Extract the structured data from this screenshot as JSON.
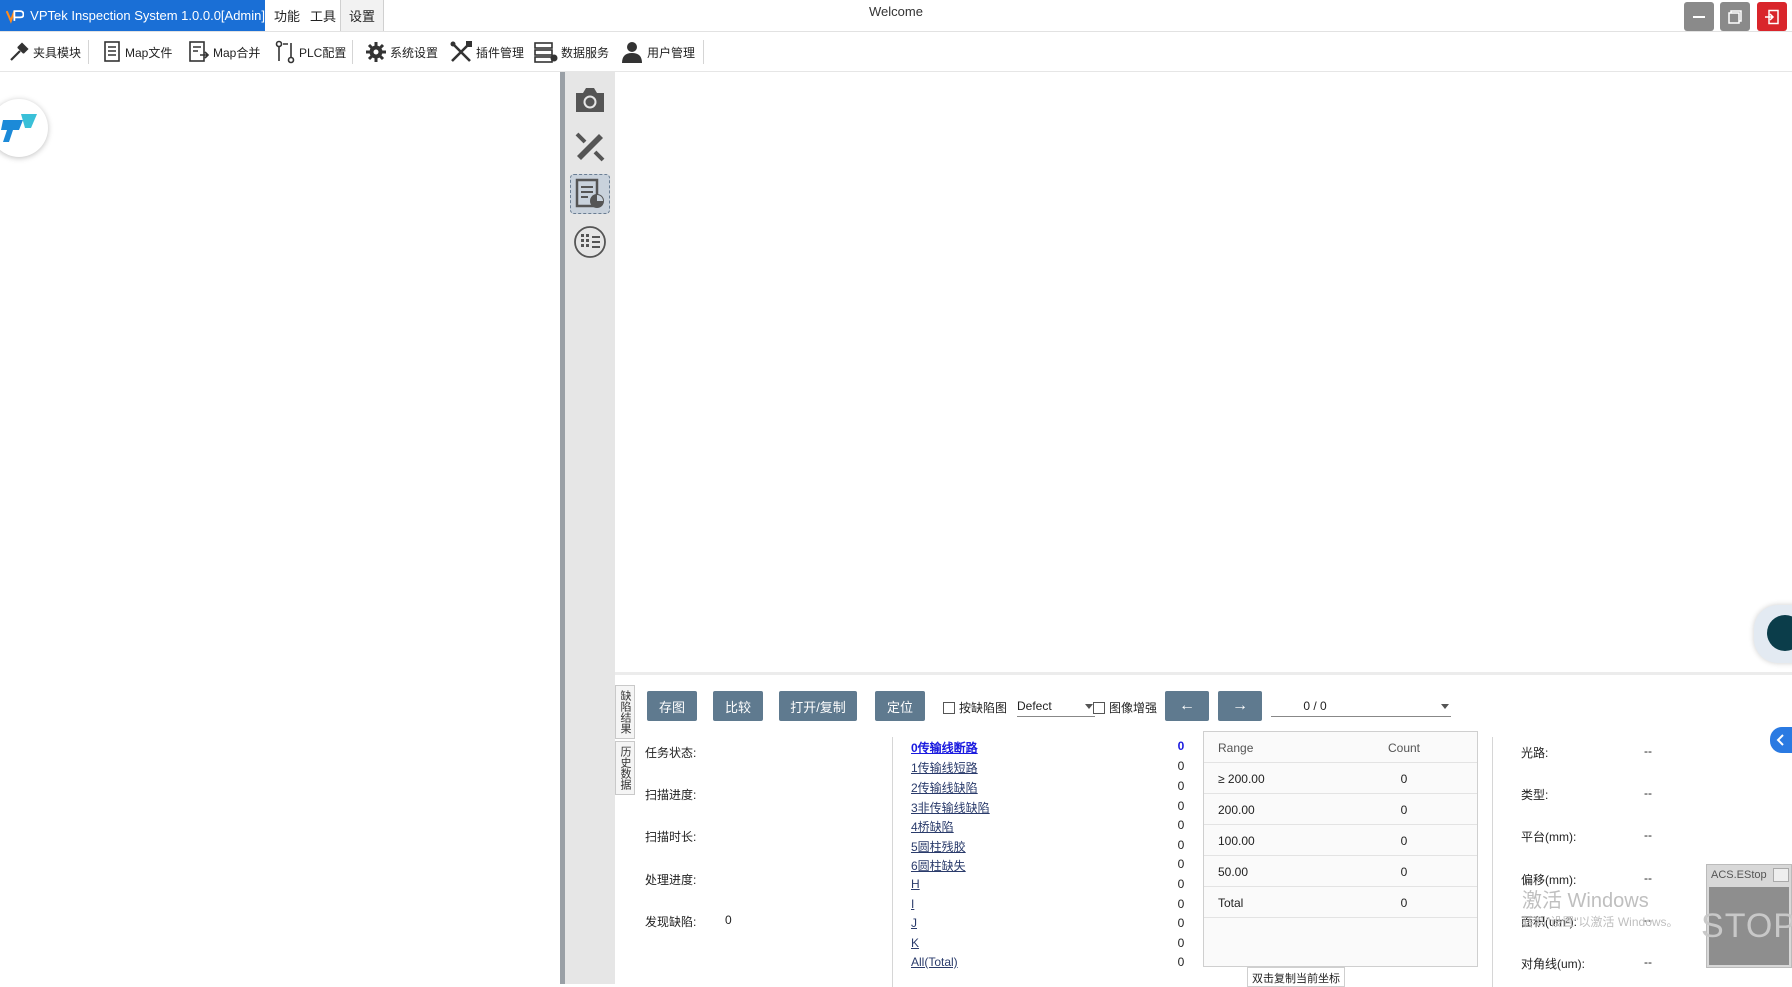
{
  "titlebar": {
    "app_name": "VPTek Inspection System 1.0.0.0[Admin]",
    "menus": [
      "功能",
      "工具",
      "设置"
    ],
    "window_title": "Welcome"
  },
  "toolbar": {
    "items": [
      {
        "label": "夹具模块",
        "icon": "fixture-icon"
      },
      {
        "label": "Map文件",
        "icon": "map-file-icon"
      },
      {
        "label": "Map合并",
        "icon": "map-merge-icon"
      },
      {
        "label": "PLC配置",
        "icon": "plc-icon"
      },
      {
        "label": "系统设置",
        "icon": "gear-icon"
      },
      {
        "label": "插件管理",
        "icon": "tools-icon"
      },
      {
        "label": "数据服务",
        "icon": "database-icon"
      },
      {
        "label": "用户管理",
        "icon": "user-icon"
      }
    ]
  },
  "side_strip": {
    "icons": [
      "camera-icon",
      "calibration-icon",
      "report-icon",
      "grid-list-icon"
    ]
  },
  "bottom": {
    "vtabs": [
      "缺陷结果",
      "历史数据"
    ],
    "buttons": {
      "save_image": "存图",
      "compare": "比较",
      "open_copy": "打开/复制",
      "locate": "定位",
      "prev": "←",
      "next": "→"
    },
    "checkbox_defect_map": "按缺陷图",
    "defect_select": "Defect",
    "checkbox_enhance": "图像增强",
    "page_indicator": "0 / 0",
    "status": {
      "task_state_label": "任务状态:",
      "task_state_value": "",
      "scan_progress_label": "扫描进度:",
      "scan_progress_value": "",
      "scan_time_label": "扫描时长:",
      "scan_time_value": "",
      "process_progress_label": "处理进度:",
      "process_progress_value": "",
      "defects_found_label": "发现缺陷:",
      "defects_found_value": "0"
    },
    "defects": [
      {
        "name": "0传输线断路",
        "count": "0"
      },
      {
        "name": "1传输线短路",
        "count": "0"
      },
      {
        "name": "2传输线缺陷",
        "count": "0"
      },
      {
        "name": "3非传输线缺陷",
        "count": "0"
      },
      {
        "name": "4桥缺陷",
        "count": "0"
      },
      {
        "name": "5圆柱残胶",
        "count": "0"
      },
      {
        "name": "6圆柱缺失",
        "count": "0"
      },
      {
        "name": "H",
        "count": "0"
      },
      {
        "name": "I",
        "count": "0"
      },
      {
        "name": "J",
        "count": "0"
      },
      {
        "name": "K",
        "count": "0"
      },
      {
        "name": "All(Total)",
        "count": "0"
      }
    ],
    "range_table": {
      "headers": [
        "Range",
        "Count"
      ],
      "rows": [
        {
          "range": "≥ 200.00",
          "count": "0"
        },
        {
          "range": "200.00",
          "count": "0"
        },
        {
          "range": "100.00",
          "count": "0"
        },
        {
          "range": "50.00",
          "count": "0"
        },
        {
          "range": "Total",
          "count": "0"
        }
      ]
    },
    "copy_coord_label": "双击复制当前坐标",
    "info": [
      {
        "label": "光路:",
        "value": "--"
      },
      {
        "label": "类型:",
        "value": "--"
      },
      {
        "label": "平台(mm):",
        "value": "--"
      },
      {
        "label": "偏移(mm):",
        "value": "--"
      },
      {
        "label": "面积(um²):",
        "value": "--"
      },
      {
        "label": "对角线(um):",
        "value": "--"
      }
    ]
  },
  "watermark": {
    "line1": "激活 Windows",
    "line2": "转到\"设置\"以激活 Windows。"
  },
  "estop": {
    "label": "ACS.EStop",
    "stop_text": "STOP"
  }
}
